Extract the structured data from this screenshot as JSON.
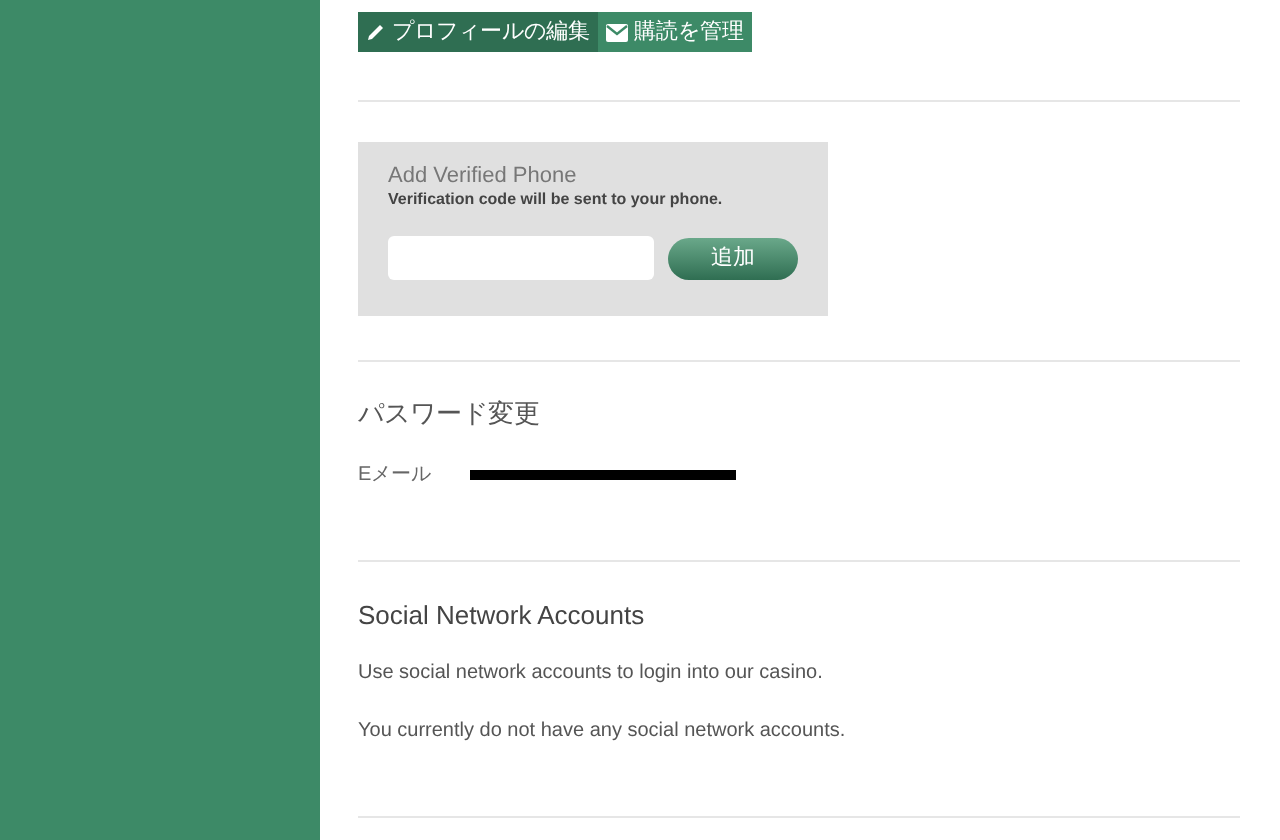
{
  "profile_buttons": [
    {
      "kind": "edit",
      "label": "プロフィールの編集",
      "selected": true
    },
    {
      "kind": "mail",
      "label": "購読を管理",
      "selected": false
    }
  ],
  "phone": {
    "title": "Add Verified Phone",
    "note": "Verification code will be sent to your phone.",
    "button": "追加"
  },
  "password": {
    "title": "パスワード変更",
    "email_label": "Eメール"
  },
  "social": {
    "title": "Social Network Accounts",
    "lines": [
      "Use social network accounts to login into our casino.",
      "You currently do not have any social network accounts."
    ]
  }
}
